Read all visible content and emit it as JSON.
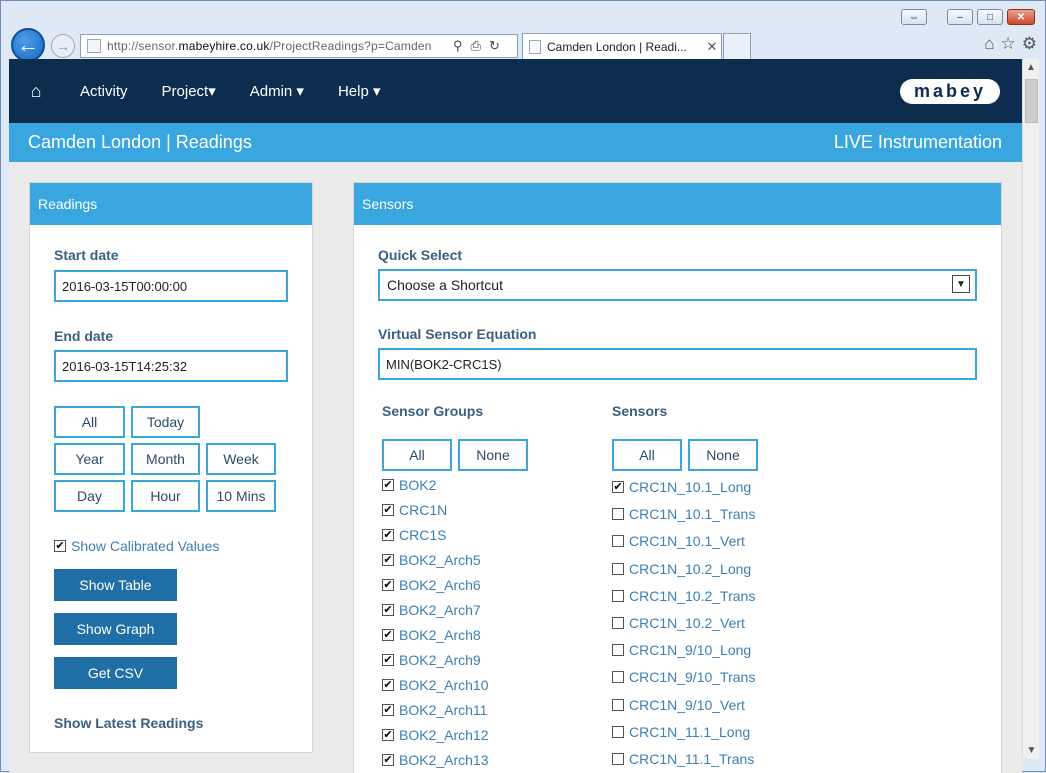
{
  "browser": {
    "url_prefix": "http://sensor.",
    "url_domain": "mabeyhire.co.uk",
    "url_path": "/ProjectReadings?p=Camden",
    "tab_title": "Camden London | Readi..."
  },
  "nav": {
    "items": [
      "Activity",
      "Project▾",
      "Admin ▾",
      "Help ▾"
    ],
    "logo": "mabey"
  },
  "titlebar": {
    "title": "Camden London | Readings",
    "right": "LIVE Instrumentation"
  },
  "readings": {
    "header": "Readings",
    "start_label": "Start date",
    "start_value": "2016-03-15T00:00:00",
    "end_label": "End date",
    "end_value": "2016-03-15T14:25:32",
    "range_buttons": [
      "All",
      "Today",
      "Year",
      "Month",
      "Week",
      "Day",
      "Hour",
      "10 Mins"
    ],
    "calibrated_label": "Show Calibrated Values",
    "calibrated_checked": true,
    "show_table": "Show Table",
    "show_graph": "Show Graph",
    "get_csv": "Get CSV",
    "latest_label": "Show Latest Readings"
  },
  "sensors": {
    "header": "Sensors",
    "quick_label": "Quick Select",
    "quick_value": "Choose a Shortcut",
    "equation_label": "Virtual Sensor Equation",
    "equation_value": "MIN(BOK2-CRC1S)",
    "groups_label": "Sensor Groups",
    "sensors_label": "Sensors",
    "all_label": "All",
    "none_label": "None",
    "groups": [
      {
        "name": "BOK2",
        "checked": true
      },
      {
        "name": "CRC1N",
        "checked": true
      },
      {
        "name": "CRC1S",
        "checked": true
      },
      {
        "name": "BOK2_Arch5",
        "checked": true
      },
      {
        "name": "BOK2_Arch6",
        "checked": true
      },
      {
        "name": "BOK2_Arch7",
        "checked": true
      },
      {
        "name": "BOK2_Arch8",
        "checked": true
      },
      {
        "name": "BOK2_Arch9",
        "checked": true
      },
      {
        "name": "BOK2_Arch10",
        "checked": true
      },
      {
        "name": "BOK2_Arch11",
        "checked": true
      },
      {
        "name": "BOK2_Arch12",
        "checked": true
      },
      {
        "name": "BOK2_Arch13",
        "checked": true
      }
    ],
    "sensor_list": [
      {
        "name": "CRC1N_10.1_Long",
        "checked": true
      },
      {
        "name": "CRC1N_10.1_Trans",
        "checked": false
      },
      {
        "name": "CRC1N_10.1_Vert",
        "checked": false
      },
      {
        "name": "CRC1N_10.2_Long",
        "checked": false
      },
      {
        "name": "CRC1N_10.2_Trans",
        "checked": false
      },
      {
        "name": "CRC1N_10.2_Vert",
        "checked": false
      },
      {
        "name": "CRC1N_9/10_Long",
        "checked": false
      },
      {
        "name": "CRC1N_9/10_Trans",
        "checked": false
      },
      {
        "name": "CRC1N_9/10_Vert",
        "checked": false
      },
      {
        "name": "CRC1N_11.1_Long",
        "checked": false
      },
      {
        "name": "CRC1N_11.1_Trans",
        "checked": false
      }
    ]
  }
}
